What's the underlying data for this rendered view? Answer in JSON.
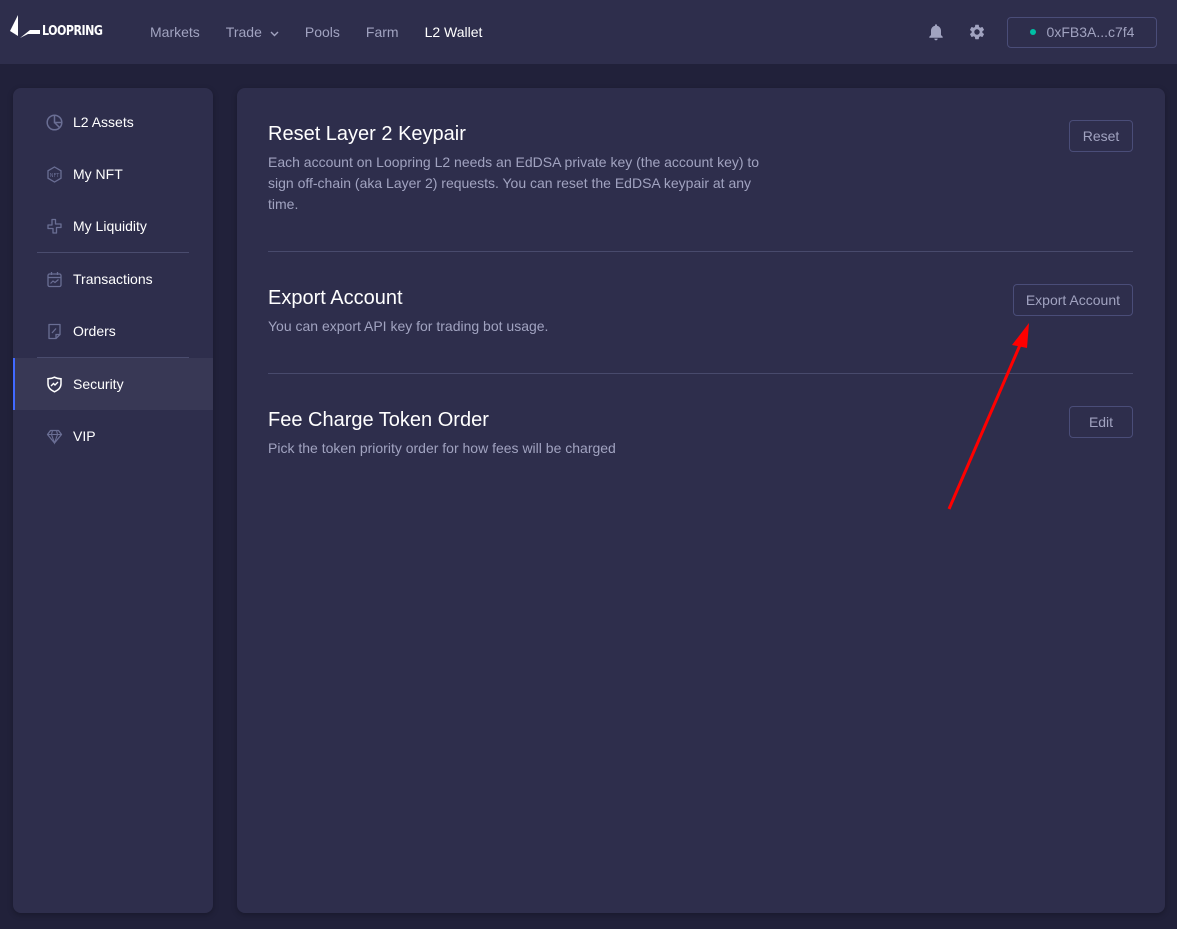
{
  "header": {
    "logo_text": "LOOPRING",
    "nav": [
      {
        "label": "Markets",
        "active": false
      },
      {
        "label": "Trade",
        "active": false,
        "has_dropdown": true
      },
      {
        "label": "Pools",
        "active": false
      },
      {
        "label": "Farm",
        "active": false
      },
      {
        "label": "L2 Wallet",
        "active": true
      }
    ],
    "icons": [
      "bell-icon",
      "gear-icon"
    ],
    "wallet": {
      "address": "0xFB3A...c7f4",
      "status_color": "#00bfa5"
    }
  },
  "sidebar": {
    "items": [
      {
        "label": "L2 Assets",
        "icon": "pie-chart-icon",
        "active": false
      },
      {
        "label": "My NFT",
        "icon": "nft-icon",
        "active": false
      },
      {
        "label": "My Liquidity",
        "icon": "liquidity-icon",
        "active": false
      },
      {
        "label": "Transactions",
        "icon": "calendar-chart-icon",
        "active": false
      },
      {
        "label": "Orders",
        "icon": "document-icon",
        "active": false
      },
      {
        "label": "Security",
        "icon": "shield-icon",
        "active": true
      },
      {
        "label": "VIP",
        "icon": "diamond-icon",
        "active": false
      }
    ],
    "accent_color": "#4169ff"
  },
  "main": {
    "sections": [
      {
        "title": "Reset Layer 2 Keypair",
        "description": "Each account on Loopring L2 needs an EdDSA private key (the account key) to sign off-chain (aka Layer 2) requests. You can reset the EdDSA keypair at any time.",
        "button": "Reset"
      },
      {
        "title": "Export Account",
        "description": "You can export API key for trading bot usage.",
        "button": "Export Account"
      },
      {
        "title": "Fee Charge Token Order",
        "description": "Pick the token priority order for how fees will be charged",
        "button": "Edit"
      }
    ]
  },
  "annotation": {
    "type": "arrow",
    "color": "#ff0000",
    "points_to": "Export Account button"
  }
}
